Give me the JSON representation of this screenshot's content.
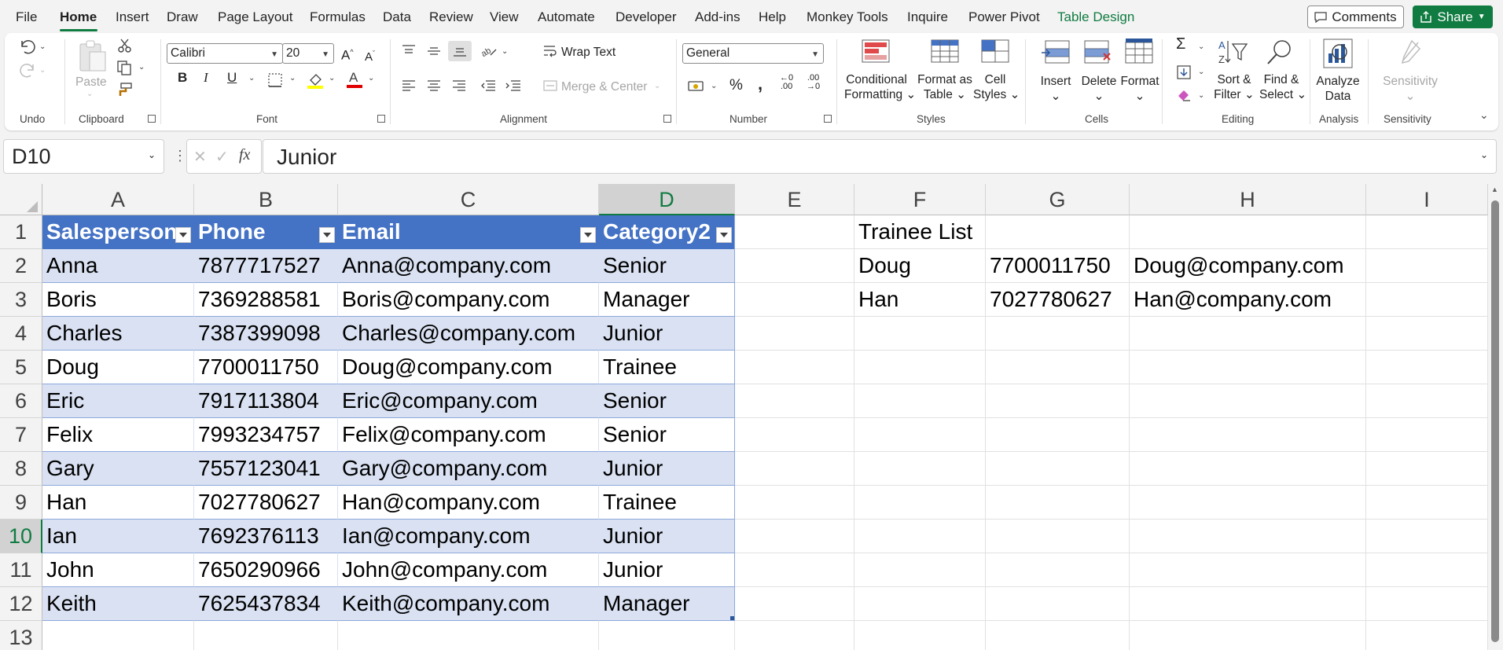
{
  "menu": [
    "File",
    "Home",
    "Insert",
    "Draw",
    "Page Layout",
    "Formulas",
    "Data",
    "Review",
    "View",
    "Automate",
    "Developer",
    "Add-ins",
    "Help",
    "Monkey Tools",
    "Inquire",
    "Power Pivot",
    "Table Design"
  ],
  "header_buttons": {
    "comments": "Comments",
    "share": "Share"
  },
  "ribbon": {
    "groups": {
      "undo": "Undo",
      "clipboard": "Clipboard",
      "font": "Font",
      "alignment": "Alignment",
      "number": "Number",
      "styles": "Styles",
      "cells": "Cells",
      "editing": "Editing",
      "analysis": "Analysis",
      "sensitivity": "Sensitivity"
    },
    "paste": "Paste",
    "font_name": "Calibri",
    "font_size": "20",
    "wrap_text": "Wrap Text",
    "merge_center": "Merge & Center",
    "number_format": "General",
    "conditional_formatting": [
      "Conditional",
      "Formatting"
    ],
    "format_as_table": [
      "Format as",
      "Table"
    ],
    "cell_styles": [
      "Cell",
      "Styles"
    ],
    "insert": "Insert",
    "delete": "Delete",
    "format": "Format",
    "sort_filter": [
      "Sort &",
      "Filter"
    ],
    "find_select": [
      "Find &",
      "Select"
    ],
    "analyze_data": [
      "Analyze",
      "Data"
    ],
    "sensitivity_btn": "Sensitivity",
    "accent_color": "#107c41"
  },
  "formula_bar": {
    "name_box": "D10",
    "formula": "Junior"
  },
  "columns": [
    "A",
    "B",
    "C",
    "D",
    "E",
    "F",
    "G",
    "H",
    "I"
  ],
  "rows": [
    "1",
    "2",
    "3",
    "4",
    "5",
    "6",
    "7",
    "8",
    "9",
    "10",
    "11",
    "12",
    "13"
  ],
  "table": {
    "headers": [
      "Salesperson",
      "Phone",
      "Email",
      "Category2"
    ],
    "rows": [
      [
        "Anna",
        "7877717527",
        "Anna@company.com",
        "Senior"
      ],
      [
        "Boris",
        "7369288581",
        "Boris@company.com",
        "Manager"
      ],
      [
        "Charles",
        "7387399098",
        "Charles@company.com",
        "Junior"
      ],
      [
        "Doug",
        "7700011750",
        "Doug@company.com",
        "Trainee"
      ],
      [
        "Eric",
        "7917113804",
        "Eric@company.com",
        "Senior"
      ],
      [
        "Felix",
        "7993234757",
        "Felix@company.com",
        "Senior"
      ],
      [
        "Gary",
        "7557123041",
        "Gary@company.com",
        "Junior"
      ],
      [
        "Han",
        "7027780627",
        "Han@company.com",
        "Trainee"
      ],
      [
        "Ian",
        "7692376113",
        "Ian@company.com",
        "Junior"
      ],
      [
        "John",
        "7650290966",
        "John@company.com",
        "Junior"
      ],
      [
        "Keith",
        "7625437834",
        "Keith@company.com",
        "Manager"
      ]
    ],
    "header_color": "#4472c4",
    "band_color": "#d9e1f2"
  },
  "trainee": {
    "title": "Trainee List",
    "rows": [
      [
        "Doug",
        "7700011750",
        "Doug@company.com"
      ],
      [
        "Han",
        "7027780627",
        "Han@company.com"
      ]
    ]
  }
}
